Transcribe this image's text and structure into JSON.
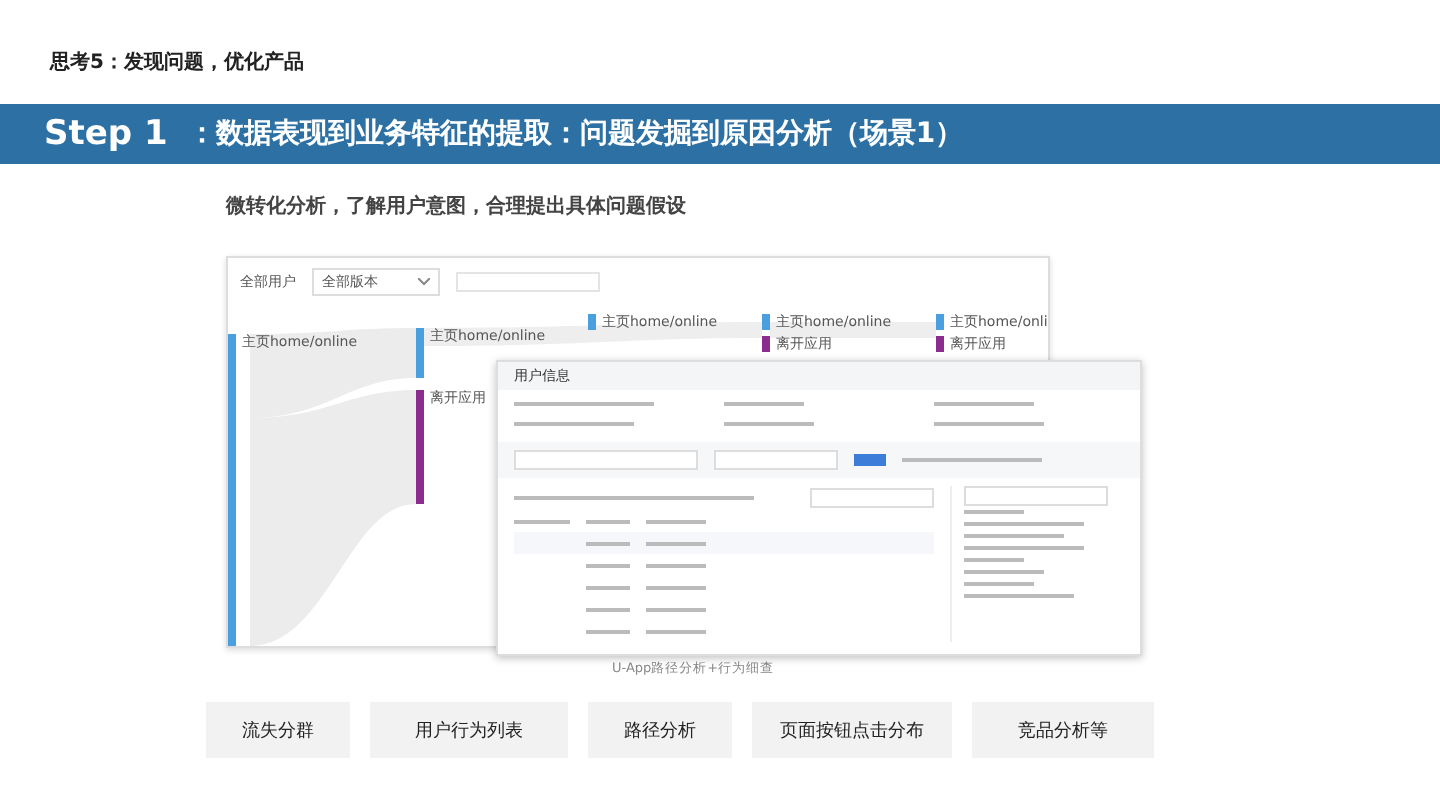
{
  "page_title": "思考5：发现问题，优化产品",
  "banner": {
    "step": "Step 1",
    "title": "：数据表现到业务特征的提取：问题发掘到原因分析（场景1）"
  },
  "subtitle": "微转化分析，了解用户意图，合理提出具体问题假设",
  "screenshot": {
    "filters": [
      {
        "label": "全部用户",
        "kind": "text"
      },
      {
        "label": "全部版本",
        "kind": "select"
      }
    ],
    "sankey_columns": [
      {
        "nodes": [
          {
            "label": "主页home/online",
            "color": "#4a9fde"
          }
        ]
      },
      {
        "nodes": [
          {
            "label": "主页home/online",
            "color": "#4a9fde"
          },
          {
            "label": "离开应用",
            "color": "#8b2c8f"
          }
        ]
      },
      {
        "nodes": [
          {
            "label": "主页home/online",
            "color": "#4a9fde"
          }
        ]
      },
      {
        "nodes": [
          {
            "label": "主页home/online",
            "color": "#4a9fde"
          },
          {
            "label": "离开应用",
            "color": "#8b2c8f"
          }
        ]
      },
      {
        "nodes": [
          {
            "label": "主页home/onli",
            "color": "#4a9fde"
          },
          {
            "label": "离开应用",
            "color": "#8b2c8f"
          }
        ]
      }
    ],
    "panel_title": "用户信息"
  },
  "caption": "U-App路径分析+行为细查",
  "tags": [
    "流失分群",
    "用户行为列表",
    "路径分析",
    "页面按钮点击分布",
    "竞品分析等"
  ]
}
